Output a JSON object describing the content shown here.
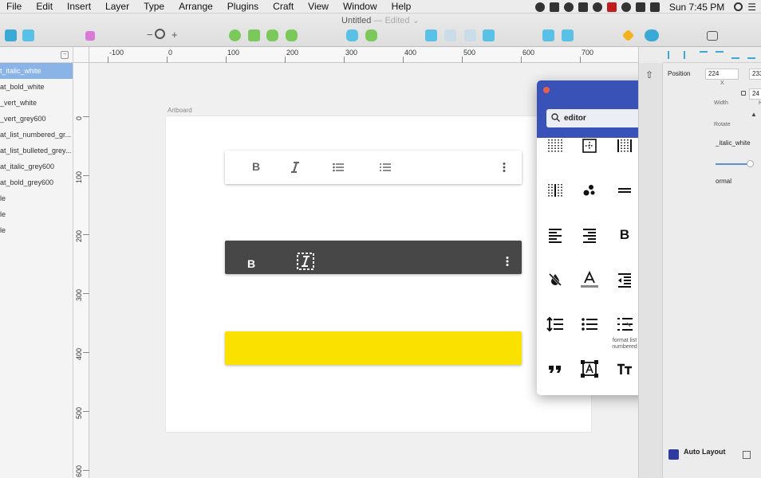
{
  "menubar": {
    "items": [
      "File",
      "Edit",
      "Insert",
      "Layer",
      "Type",
      "Arrange",
      "Plugins",
      "Craft",
      "View",
      "Window",
      "Help"
    ],
    "clock": "Sun 7:45 PM"
  },
  "toolbar": {
    "title": "Untitled",
    "status": "— Edited ⌄"
  },
  "ruler": {
    "h_labels": [
      "-100",
      "0",
      "100",
      "200",
      "300",
      "400",
      "500",
      "600",
      "700"
    ],
    "v_labels": [
      "0",
      "100",
      "200",
      "300",
      "400",
      "500",
      "600"
    ]
  },
  "layers": {
    "items": [
      "t_italic_white",
      "at_bold_white",
      "_vert_white",
      "_vert_grey600",
      "at_list_numbered_gr...",
      "at_list_bulleted_grey...",
      "at_italic_grey600",
      "at_bold_grey600",
      "le",
      "le",
      "le"
    ]
  },
  "canvas": {
    "artboard_label": "Artboard",
    "bar1": {
      "bold": "B"
    },
    "bar2": {
      "bold": "B"
    }
  },
  "popup": {
    "search_value": "editor",
    "tooltip": "format list numbered"
  },
  "inspector": {
    "position_label": "Position",
    "x_value": "224",
    "y_value": "233",
    "x_label": "X",
    "width_label": "Width",
    "height_label": "H",
    "w_value": "24",
    "rotate_label": "Rotate",
    "symbol_label": "_italic_white",
    "normal_label": "ormal",
    "auto_layout": "Auto Layout"
  },
  "colors": {
    "popup_header": "#3952b8",
    "toolbar_yellow": "#fae100",
    "toolbar_dark": "#474747",
    "selection": "#8ab4e8"
  }
}
